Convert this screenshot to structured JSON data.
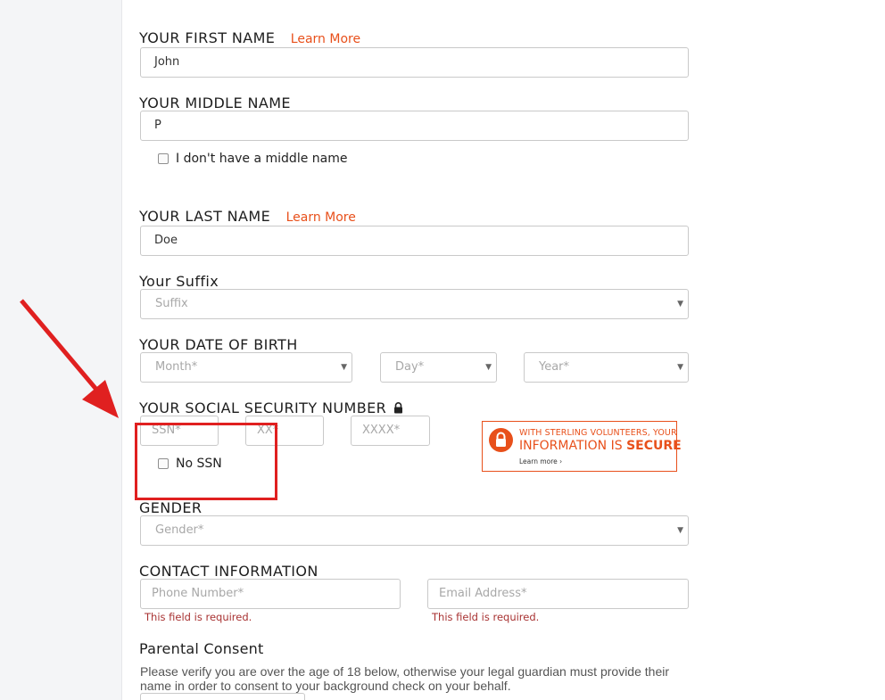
{
  "first_name": {
    "label": "YOUR FIRST NAME",
    "learn_more": "Learn More",
    "value": "John"
  },
  "middle_name": {
    "label": "YOUR MIDDLE NAME",
    "value": "P",
    "no_middle_label": "I don't have a middle name"
  },
  "last_name": {
    "label": "YOUR LAST NAME",
    "learn_more": "Learn More",
    "value": "Doe"
  },
  "suffix": {
    "label": "Your Suffix",
    "placeholder": "Suffix"
  },
  "dob": {
    "label": "YOUR DATE OF BIRTH",
    "month_placeholder": "Month*",
    "day_placeholder": "Day*",
    "year_placeholder": "Year*"
  },
  "ssn": {
    "label": "YOUR SOCIAL SECURITY NUMBER",
    "part1_placeholder": "SSN*",
    "part2_placeholder": "XX*",
    "part3_placeholder": "XXXX*",
    "no_ssn_label": "No SSN"
  },
  "secure_banner": {
    "line1": "WITH STERLING VOLUNTEERS, YOUR",
    "line2_prefix": "INFORMATION IS ",
    "line2_bold": "SECURE",
    "link": "Learn more ›"
  },
  "gender": {
    "label": "GENDER",
    "placeholder": "Gender*"
  },
  "contact": {
    "label": "CONTACT INFORMATION",
    "phone_placeholder": "Phone Number*",
    "email_placeholder": "Email Address*",
    "phone_error": "This field is required.",
    "email_error": "This field is required."
  },
  "parental_consent": {
    "label": "Parental Consent",
    "description": "Please verify you are over the age of 18 below, otherwise your legal guardian must provide their name in order to consent to your background check on your behalf."
  },
  "colors": {
    "accent": "#e8501b",
    "error": "#a83232",
    "annotation": "#e02020"
  }
}
